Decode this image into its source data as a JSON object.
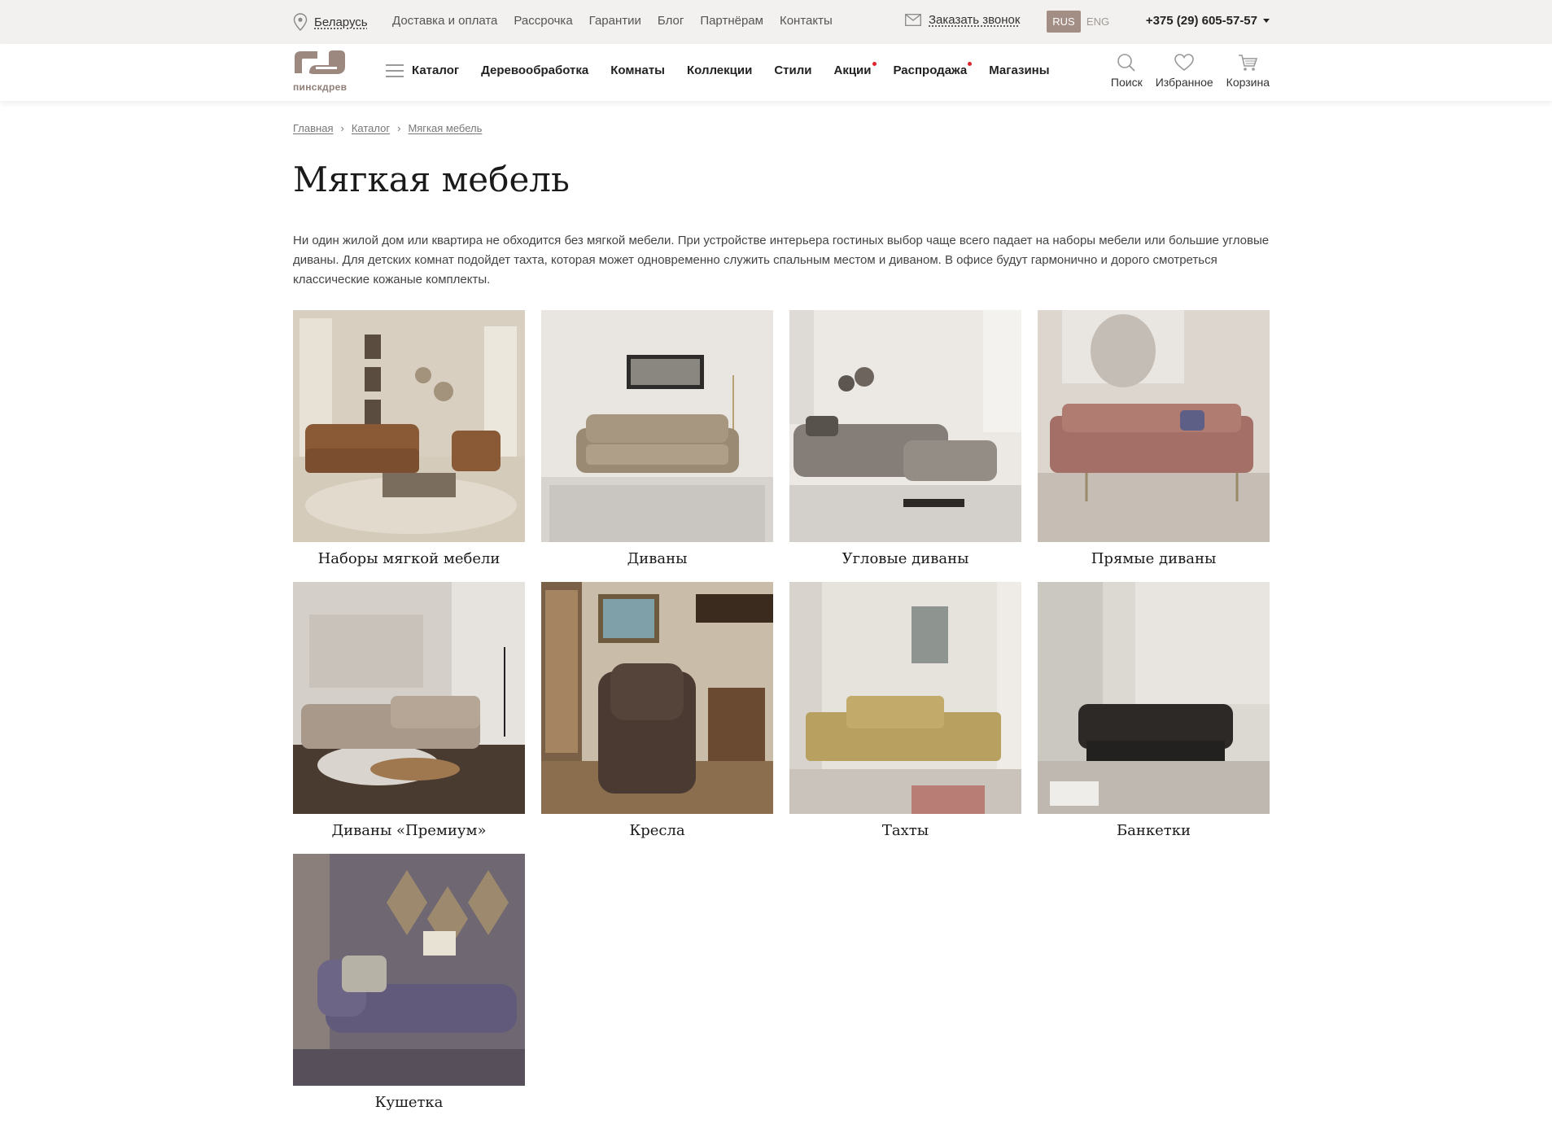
{
  "topbar": {
    "region": "Беларусь",
    "links": [
      "Доставка и оплата",
      "Рассрочка",
      "Гарантии",
      "Блог",
      "Партнёрам",
      "Контакты"
    ],
    "callback": "Заказать звонок",
    "lang_active": "RUS",
    "lang_other": "ENG",
    "phone": "+375 (29) 605-57-57"
  },
  "header": {
    "logo_text": "пинскдрев",
    "menu": [
      "Каталог",
      "Деревообработка",
      "Комнаты",
      "Коллекции",
      "Стили",
      "Акции",
      "Распродажа",
      "Магазины"
    ],
    "tools": {
      "search": "Поиск",
      "favorites": "Избранное",
      "cart": "Корзина"
    },
    "accent": "#a38e86",
    "badge_color": "#e0242c"
  },
  "breadcrumb": [
    "Главная",
    "Каталог",
    "Мягкая мебель"
  ],
  "page": {
    "title": "Мягкая мебель",
    "intro": "Ни один жилой дом или квартира не обходится без мягкой мебели. При устройстве интерьера гостиных выбор чаще всего падает на наборы мебели или большие угловые диваны. Для детских комнат подойдет тахта, которая может одновременно служить спальным местом и диваном. В офисе будут гармонично и дорого смотреться классические кожаные комплекты."
  },
  "categories": [
    {
      "name": "Наборы мягкой мебели",
      "icon": "living-room-set-photo"
    },
    {
      "name": "Диваны",
      "icon": "sofa-photo"
    },
    {
      "name": "Угловые диваны",
      "icon": "corner-sofa-photo"
    },
    {
      "name": "Прямые диваны",
      "icon": "straight-sofa-photo"
    },
    {
      "name": "Диваны «Премиум»",
      "icon": "premium-sofa-photo"
    },
    {
      "name": "Кресла",
      "icon": "armchair-photo"
    },
    {
      "name": "Тахты",
      "icon": "daybed-photo"
    },
    {
      "name": "Банкетки",
      "icon": "ottoman-photo"
    },
    {
      "name": "Кушетка",
      "icon": "couch-photo"
    }
  ]
}
